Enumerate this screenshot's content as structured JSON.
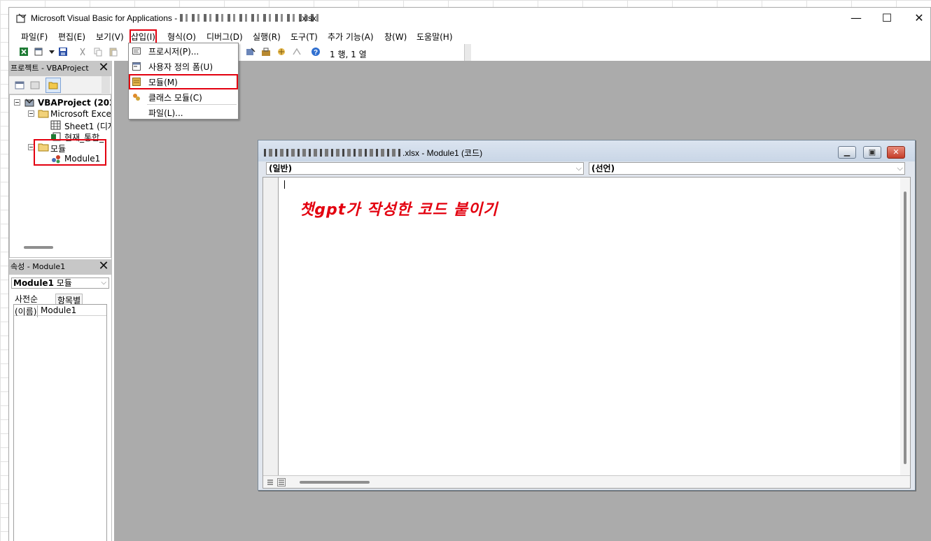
{
  "window": {
    "title": "Microsoft Visual Basic for Applications - ",
    "title_ext": ".xlsx",
    "minimize": "—",
    "maximize": "☐",
    "close": "✕"
  },
  "menu": [
    {
      "label": "파일(F)"
    },
    {
      "label": "편집(E)"
    },
    {
      "label": "보기(V)"
    },
    {
      "label": "삽입(I)"
    },
    {
      "label": "형식(O)"
    },
    {
      "label": "디버그(D)"
    },
    {
      "label": "실행(R)"
    },
    {
      "label": "도구(T)"
    },
    {
      "label": "추가 기능(A)"
    },
    {
      "label": "창(W)"
    },
    {
      "label": "도움말(H)"
    }
  ],
  "toolbar": {
    "position": "1 행, 1 열"
  },
  "insert_menu": {
    "items": [
      {
        "label": "프로시저(P)..."
      },
      {
        "label": "사용자 정의 폼(U)"
      },
      {
        "label": "모듈(M)"
      },
      {
        "label": "클래스 모듈(C)"
      },
      {
        "label": "파일(L)..."
      }
    ]
  },
  "project_panel": {
    "title": "프로젝트 - VBAProject",
    "close": "✕",
    "tree": {
      "project": "VBAProject (202",
      "excel_objects": "Microsoft Exce",
      "sheet1": "Sheet1 (디자",
      "workbook": "현재_통합_",
      "modules_folder": "모듈",
      "module1": "Module1"
    }
  },
  "properties_panel": {
    "title": "속성 - Module1",
    "close": "✕",
    "combo_name": "Module1",
    "combo_type": "모듈",
    "tab_alpha": "사전순",
    "tab_category": "항목별",
    "prop_name": "(이름)",
    "prop_value": "Module1"
  },
  "code_window": {
    "title_suffix": ".xlsx - Module1 (코드)",
    "object_combo": "(일반)",
    "procedure_combo": "(선언)",
    "annotation": "챗gpt가 작성한 코드 붙이기"
  },
  "colors": {
    "highlight": "#e3000f",
    "mdi_background": "#ababab",
    "panel_title": "#c7c7c7"
  }
}
